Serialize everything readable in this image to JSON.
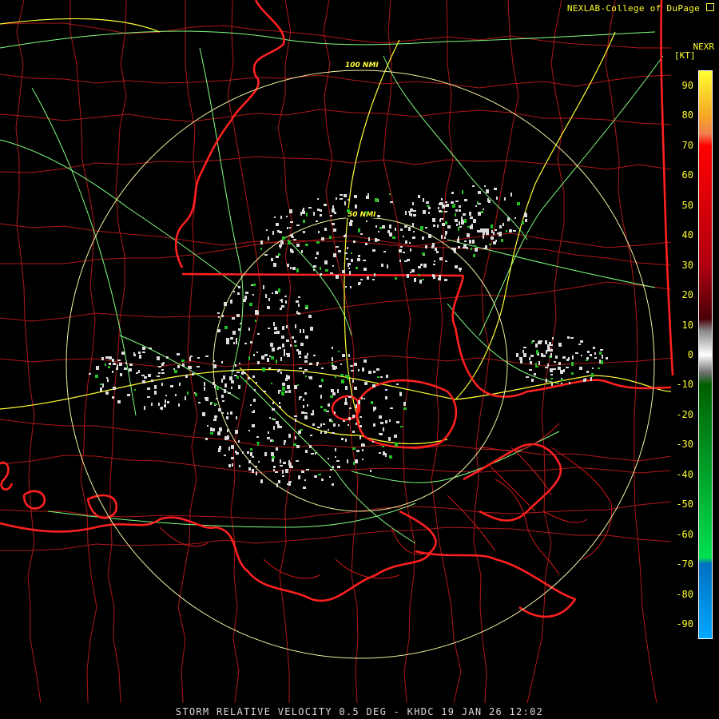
{
  "header": {
    "credit": "NEXLAB-College of DuPage",
    "product": "NEXR",
    "unit": "[KT]"
  },
  "footer": {
    "caption": "STORM RELATIVE VELOCITY 0.5 DEG - KHDC 19 JAN 26 12:02"
  },
  "range_rings": [
    {
      "label": "100 NMI"
    },
    {
      "label": "50 NMI"
    }
  ],
  "legend": {
    "ticks": [
      "90",
      "80",
      "70",
      "60",
      "50",
      "40",
      "30",
      "20",
      "10",
      "0",
      "-10",
      "-20",
      "-30",
      "-40",
      "-50",
      "-60",
      "-70",
      "-80",
      "-90"
    ],
    "gradient_stops": [
      {
        "v": 95,
        "color": "#ffff33"
      },
      {
        "v": 80,
        "color": "#f5a623"
      },
      {
        "v": 74,
        "color": "#f08050"
      },
      {
        "v": 70,
        "color": "#ff0000"
      },
      {
        "v": 30,
        "color": "#b00010"
      },
      {
        "v": 12,
        "color": "#4a0008"
      },
      {
        "v": 8,
        "color": "#888888"
      },
      {
        "v": 0,
        "color": "#ffffff"
      },
      {
        "v": -6,
        "color": "#707070"
      },
      {
        "v": -10,
        "color": "#006000"
      },
      {
        "v": -68,
        "color": "#00e050"
      },
      {
        "v": -70,
        "color": "#0070c0"
      },
      {
        "v": -95,
        "color": "#00a8ff"
      }
    ]
  },
  "colors": {
    "state_border": "#ff2020",
    "county_border": "#b01818",
    "interstate": "#ffff33",
    "highway": "#80ff80",
    "range_ring": "#f5f0a0",
    "radar_echo": "#dcdcdc",
    "inbound_echo": "#22c022"
  }
}
